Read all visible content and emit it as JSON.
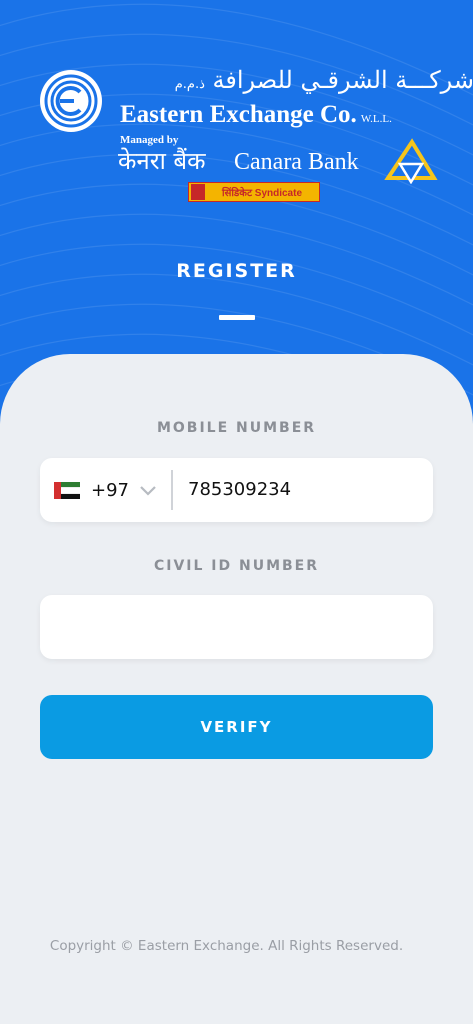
{
  "brand": {
    "arabic_name": "شركـــة الشرقـي للصرافة",
    "arabic_suffix": "ذ.م.م",
    "english_name": "Eastern Exchange Co.",
    "english_suffix": "W.L.L.",
    "managed_by": "Managed by",
    "canara_hindi": "केनरा बैंक",
    "canara_english": "Canara Bank",
    "syndicate_text": "सिंडिकेट Syndicate",
    "logo_icon": "eastern-exchange-logo-icon",
    "canara_icon": "canara-bank-logo-icon"
  },
  "header": {
    "title": "REGISTER"
  },
  "form": {
    "mobile": {
      "label": "MOBILE NUMBER",
      "country_code": "+97",
      "country_flag": "uae-flag-icon",
      "value": "785309234"
    },
    "civil_id": {
      "label": "CIVIL ID NUMBER",
      "value": "",
      "placeholder": ""
    },
    "verify_label": "VERIFY"
  },
  "footer": {
    "copyright": "Copyright © Eastern Exchange. All Rights Reserved."
  },
  "colors": {
    "header_bg": "#1a73e8",
    "card_bg": "#eceff3",
    "button_bg": "#0a9be3",
    "label_color": "#8b8f96"
  }
}
